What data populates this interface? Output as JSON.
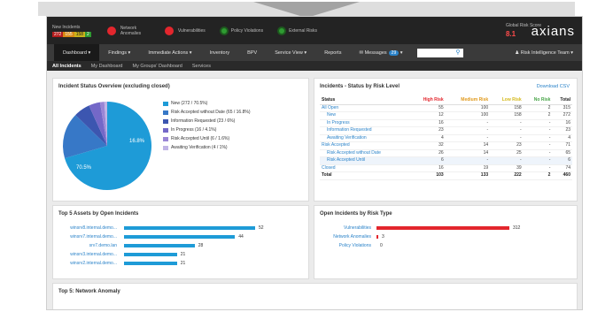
{
  "topbar": {
    "new_incidents_label": "New Incidents",
    "new_incidents_counts": [
      "272",
      "155",
      "158",
      "2"
    ],
    "network_anomalies_label": "Network Anomalies",
    "vulnerabilities_label": "Vulnerabilities",
    "policy_violations_label": "Policy Violations",
    "external_risks_label": "External Risks",
    "global_risk_label": "Global Risk Score",
    "global_risk_value": "8.1",
    "logo_text": "axians"
  },
  "navbar": {
    "items": [
      "Dashboard",
      "Findings",
      "Immediate Actions",
      "Inventory",
      "BPV",
      "Service View",
      "Reports"
    ],
    "messages_label": "Messages",
    "messages_count": "29",
    "risk_team_label": "Risk Intelligence Team"
  },
  "subnav": {
    "items": [
      "All Incidents",
      "My Dashboard",
      "My Groups' Dashboard",
      "Services"
    ]
  },
  "pie_card": {
    "title": "Incident Status Overview (excluding closed)",
    "legend": [
      {
        "label": "New (272 / 70.5%)",
        "color": "#1e9bd7"
      },
      {
        "label": "Risk Accepted without Date (65 / 16.8%)",
        "color": "#3778c7"
      },
      {
        "label": "Information Requested (23 / 6%)",
        "color": "#3c56b0"
      },
      {
        "label": "In Progress (16 / 4.1%)",
        "color": "#7468c8"
      },
      {
        "label": "Risk Accepted Until (6 / 1.6%)",
        "color": "#9a86d6"
      },
      {
        "label": "Awaiting Verification (4 / 1%)",
        "color": "#c0b4e6"
      }
    ],
    "slice_values": [
      272,
      65,
      23,
      16,
      6,
      4
    ],
    "big_label": "70.5%",
    "second_label": "16.8%"
  },
  "risk_card": {
    "title": "Incidents - Status by Risk Level",
    "link": "Download CSV",
    "columns": [
      "Status",
      "High Risk",
      "Medium Risk",
      "Low Risk",
      "No Risk",
      "Total"
    ],
    "column_colors": [
      "#222222",
      "#e3262d",
      "#e0991b",
      "#d4b81a",
      "#47a447",
      "#222222"
    ],
    "rows": [
      {
        "cells": [
          "All Open",
          "55",
          "100",
          "158",
          "2",
          "315"
        ],
        "type": "main"
      },
      {
        "cells": [
          "New",
          "12",
          "100",
          "158",
          "2",
          "272"
        ],
        "type": "sub"
      },
      {
        "cells": [
          "In Progress",
          "16",
          "-",
          "-",
          "-",
          "16"
        ],
        "type": "sub"
      },
      {
        "cells": [
          "Information Requested",
          "23",
          "-",
          "-",
          "-",
          "23"
        ],
        "type": "sub"
      },
      {
        "cells": [
          "Awaiting Verification",
          "4",
          "-",
          "-",
          "-",
          "4"
        ],
        "type": "sub"
      },
      {
        "cells": [
          "Risk Accepted",
          "32",
          "14",
          "23",
          "-",
          "71"
        ],
        "type": "main"
      },
      {
        "cells": [
          "Risk Accepted without Date",
          "26",
          "14",
          "25",
          "-",
          "65"
        ],
        "type": "sub"
      },
      {
        "cells": [
          "Risk Accepted Until",
          "6",
          "-",
          "-",
          "-",
          "6"
        ],
        "type": "sub alt"
      },
      {
        "cells": [
          "Closed",
          "16",
          "19",
          "39",
          "-",
          "74"
        ],
        "type": "main"
      },
      {
        "cells": [
          "Total",
          "103",
          "133",
          "222",
          "2",
          "460"
        ],
        "type": "total"
      }
    ]
  },
  "assets_card": {
    "title": "Top 5 Assets by Open Incidents",
    "bar_color": "#1e9bd7",
    "max": 52,
    "rows": [
      {
        "label": "winsrv8.internal.demo...",
        "value": 52
      },
      {
        "label": "winsrv7.internal.demo...",
        "value": 44
      },
      {
        "label": "srv7.demo.lan",
        "value": 28
      },
      {
        "label": "winsrv3.internal.demo...",
        "value": 21
      },
      {
        "label": "winsrv2.internal.demo...",
        "value": 21
      }
    ]
  },
  "risk_type_card": {
    "title": "Open Incidents by Risk Type",
    "bar_color": "#e3262d",
    "max": 312,
    "rows": [
      {
        "label": "Vulnerabilities",
        "value": 312
      },
      {
        "label": "Network Anomalies",
        "value": 3
      },
      {
        "label": "Policy Violations",
        "value": 0
      }
    ]
  },
  "anomaly_card": {
    "title": "Top 5: Network Anomaly"
  }
}
